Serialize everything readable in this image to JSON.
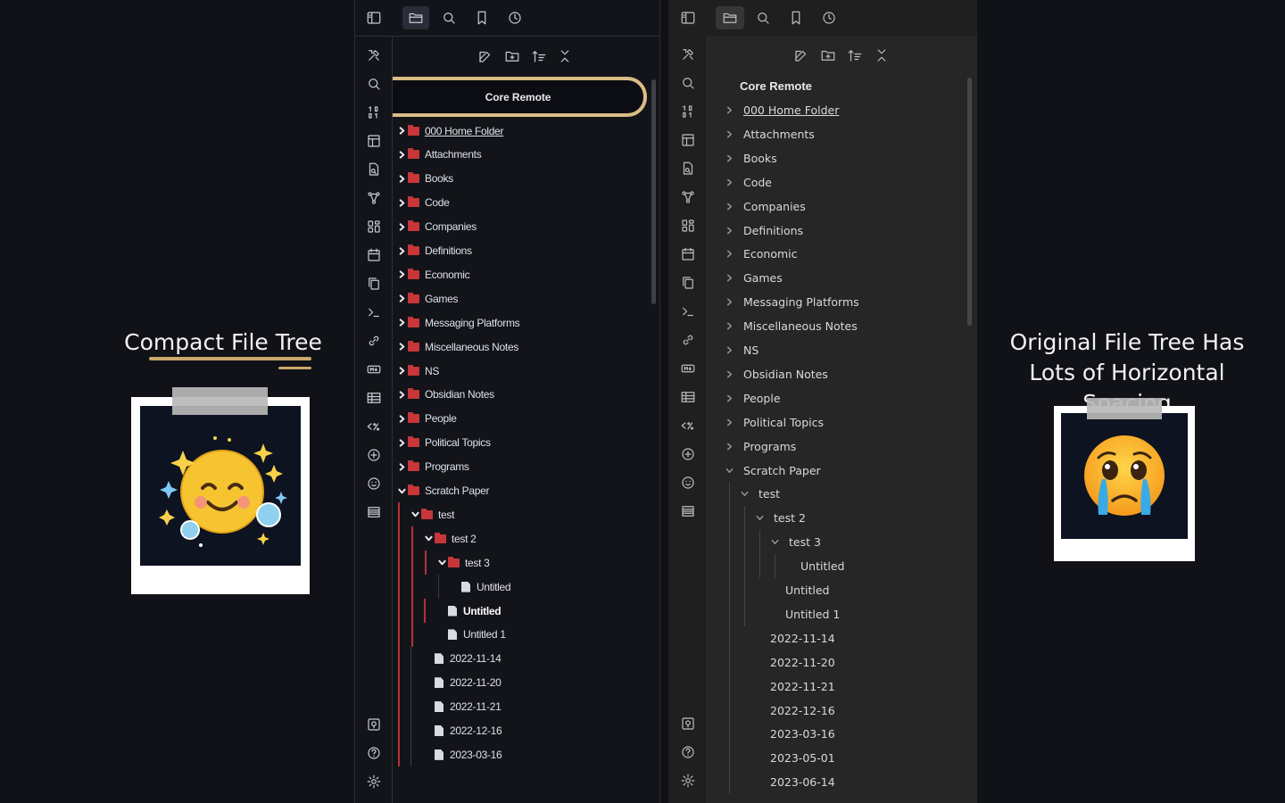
{
  "captions": {
    "left": "Compact File Tree",
    "right": "Original File Tree Has Lots of Horizontal Spacing"
  },
  "colors": {
    "accent_gold": "#c9a86a",
    "folder_red": "#c8363a",
    "guide_red": "#b3323a"
  },
  "compact": {
    "vault_name": "Core Remote",
    "rows": [
      {
        "label": "000 Home Folder",
        "type": "folder",
        "depth": 0,
        "expanded": false,
        "link": true
      },
      {
        "label": "Attachments",
        "type": "folder",
        "depth": 0,
        "expanded": false
      },
      {
        "label": "Books",
        "type": "folder",
        "depth": 0,
        "expanded": false
      },
      {
        "label": "Code",
        "type": "folder",
        "depth": 0,
        "expanded": false
      },
      {
        "label": "Companies",
        "type": "folder",
        "depth": 0,
        "expanded": false
      },
      {
        "label": "Definitions",
        "type": "folder",
        "depth": 0,
        "expanded": false
      },
      {
        "label": "Economic",
        "type": "folder",
        "depth": 0,
        "expanded": false
      },
      {
        "label": "Games",
        "type": "folder",
        "depth": 0,
        "expanded": false
      },
      {
        "label": "Messaging Platforms",
        "type": "folder",
        "depth": 0,
        "expanded": false
      },
      {
        "label": "Miscellaneous Notes",
        "type": "folder",
        "depth": 0,
        "expanded": false
      },
      {
        "label": "NS",
        "type": "folder",
        "depth": 0,
        "expanded": false
      },
      {
        "label": "Obsidian Notes",
        "type": "folder",
        "depth": 0,
        "expanded": false
      },
      {
        "label": "People",
        "type": "folder",
        "depth": 0,
        "expanded": false
      },
      {
        "label": "Political Topics",
        "type": "folder",
        "depth": 0,
        "expanded": false
      },
      {
        "label": "Programs",
        "type": "folder",
        "depth": 0,
        "expanded": false
      },
      {
        "label": "Scratch Paper",
        "type": "folder",
        "depth": 0,
        "expanded": true
      },
      {
        "label": "test",
        "type": "folder",
        "depth": 1,
        "expanded": true
      },
      {
        "label": "test 2",
        "type": "folder",
        "depth": 2,
        "expanded": true
      },
      {
        "label": "test 3",
        "type": "folder",
        "depth": 3,
        "expanded": true
      },
      {
        "label": "Untitled",
        "type": "file",
        "depth": 4
      },
      {
        "label": "Untitled",
        "type": "file",
        "depth": 3,
        "active": true
      },
      {
        "label": "Untitled 1",
        "type": "file",
        "depth": 3
      },
      {
        "label": "2022-11-14",
        "type": "file",
        "depth": 2
      },
      {
        "label": "2022-11-20",
        "type": "file",
        "depth": 2
      },
      {
        "label": "2022-11-21",
        "type": "file",
        "depth": 2
      },
      {
        "label": "2022-12-16",
        "type": "file",
        "depth": 2
      },
      {
        "label": "2023-03-16",
        "type": "file",
        "depth": 2
      }
    ]
  },
  "original": {
    "vault_name": "Core Remote",
    "rows": [
      {
        "label": "000 Home Folder",
        "type": "folder",
        "depth": 0,
        "expanded": false,
        "link": true
      },
      {
        "label": "Attachments",
        "type": "folder",
        "depth": 0,
        "expanded": false
      },
      {
        "label": "Books",
        "type": "folder",
        "depth": 0,
        "expanded": false
      },
      {
        "label": "Code",
        "type": "folder",
        "depth": 0,
        "expanded": false
      },
      {
        "label": "Companies",
        "type": "folder",
        "depth": 0,
        "expanded": false
      },
      {
        "label": "Definitions",
        "type": "folder",
        "depth": 0,
        "expanded": false
      },
      {
        "label": "Economic",
        "type": "folder",
        "depth": 0,
        "expanded": false
      },
      {
        "label": "Games",
        "type": "folder",
        "depth": 0,
        "expanded": false
      },
      {
        "label": "Messaging Platforms",
        "type": "folder",
        "depth": 0,
        "expanded": false
      },
      {
        "label": "Miscellaneous Notes",
        "type": "folder",
        "depth": 0,
        "expanded": false
      },
      {
        "label": "NS",
        "type": "folder",
        "depth": 0,
        "expanded": false
      },
      {
        "label": "Obsidian Notes",
        "type": "folder",
        "depth": 0,
        "expanded": false
      },
      {
        "label": "People",
        "type": "folder",
        "depth": 0,
        "expanded": false
      },
      {
        "label": "Political Topics",
        "type": "folder",
        "depth": 0,
        "expanded": false
      },
      {
        "label": "Programs",
        "type": "folder",
        "depth": 0,
        "expanded": false
      },
      {
        "label": "Scratch Paper",
        "type": "folder",
        "depth": 0,
        "expanded": true
      },
      {
        "label": "test",
        "type": "folder",
        "depth": 1,
        "expanded": true
      },
      {
        "label": "test 2",
        "type": "folder",
        "depth": 2,
        "expanded": true
      },
      {
        "label": "test 3",
        "type": "folder",
        "depth": 3,
        "expanded": true
      },
      {
        "label": "Untitled",
        "type": "file",
        "depth": 4
      },
      {
        "label": "Untitled",
        "type": "file",
        "depth": 3
      },
      {
        "label": "Untitled 1",
        "type": "file",
        "depth": 3
      },
      {
        "label": "2022-11-14",
        "type": "file",
        "depth": 2
      },
      {
        "label": "2022-11-20",
        "type": "file",
        "depth": 2
      },
      {
        "label": "2022-11-21",
        "type": "file",
        "depth": 2
      },
      {
        "label": "2022-12-16",
        "type": "file",
        "depth": 2
      },
      {
        "label": "2023-03-16",
        "type": "file",
        "depth": 2
      },
      {
        "label": "2023-05-01",
        "type": "file",
        "depth": 2
      },
      {
        "label": "2023-06-14",
        "type": "file",
        "depth": 2
      }
    ]
  },
  "top_tabs": [
    "sidebar-toggle-icon",
    "files-icon",
    "search-icon",
    "bookmark-icon",
    "clock-icon"
  ],
  "nav_actions": [
    "new-note-icon",
    "new-folder-icon",
    "sort-icon",
    "collapse-all-icon"
  ],
  "ribbon_icons": [
    "tools-icon",
    "search-icon",
    "numbers-icon",
    "layout-icon",
    "file-search-icon",
    "graph-icon",
    "grid-icon",
    "calendar-icon",
    "copy-icon",
    "terminal-icon",
    "link-icon",
    "markdown-icon",
    "table-icon",
    "percent-code-icon",
    "plus-circle-icon",
    "smile-icon",
    "lines-icon"
  ],
  "ribbon_bottom_icons": [
    "vault-icon",
    "help-icon",
    "settings-icon"
  ],
  "emoji": {
    "left": "happy-smile-sparkles",
    "right": "crying-face"
  }
}
